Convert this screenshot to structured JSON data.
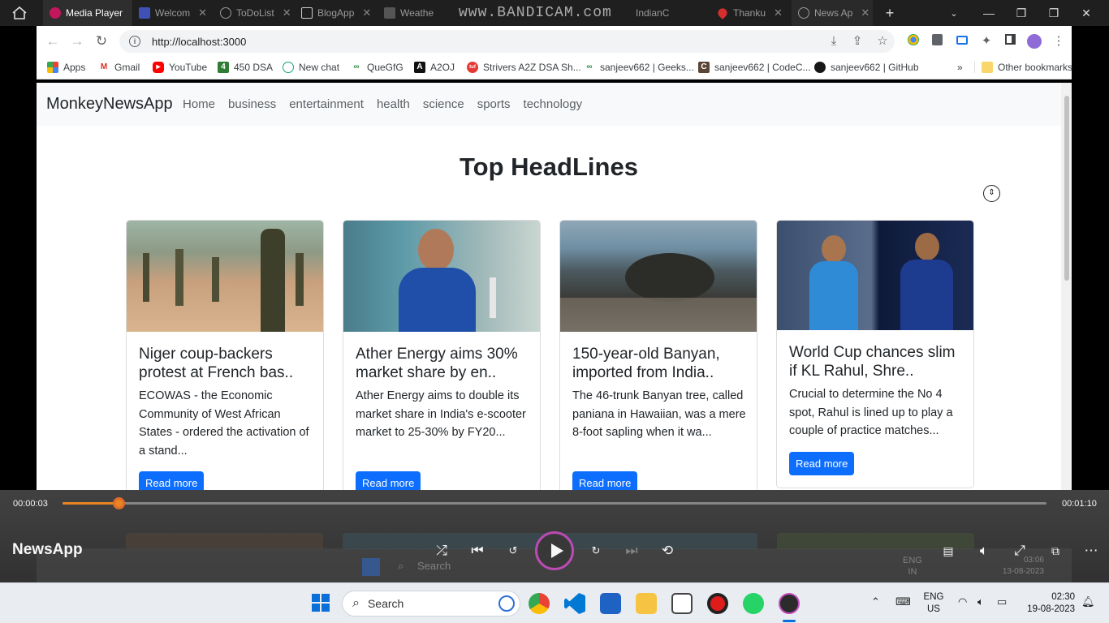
{
  "tabs": [
    {
      "label": "Media Player",
      "active": true
    },
    {
      "label": "Welcom",
      "active": false
    },
    {
      "label": "ToDoList",
      "active": false
    },
    {
      "label": "BlogApp",
      "active": false
    },
    {
      "label": "Weathe",
      "active": false
    },
    {
      "label": "IndianC",
      "active": false
    },
    {
      "label": "Thanku",
      "active": false
    },
    {
      "label": "News Ap",
      "active": false
    }
  ],
  "watermark": "www.BANDICAM.com",
  "address": {
    "url": "http://localhost:3000"
  },
  "bookmarks": [
    {
      "label": "Apps",
      "color": "#ea4335"
    },
    {
      "label": "Gmail",
      "color": "#d93025"
    },
    {
      "label": "YouTube",
      "color": "#ff0000"
    },
    {
      "label": "450 DSA",
      "color": "#2e7d32"
    },
    {
      "label": "New chat",
      "color": "#10a37f"
    },
    {
      "label": "QueGfG",
      "color": "#2f8d46"
    },
    {
      "label": "A2OJ",
      "color": "#111111"
    },
    {
      "label": "Strivers A2Z DSA Sh...",
      "color": "#e53935"
    },
    {
      "label": "sanjeev662 | Geeks...",
      "color": "#2f8d46"
    },
    {
      "label": "sanjeev662 | CodeC...",
      "color": "#5b4636"
    },
    {
      "label": "sanjeev662 | GitHub",
      "color": "#181717"
    }
  ],
  "bookmarks_more": "»",
  "other_bookmarks": "Other bookmarks",
  "navbar": {
    "brand": "MonkeyNewsApp",
    "links": [
      "Home",
      "business",
      "entertainment",
      "health",
      "science",
      "sports",
      "technology"
    ]
  },
  "page_title": "Top HeadLines",
  "cards": [
    {
      "title": "Niger coup-backers protest at French bas..",
      "desc": "ECOWAS - the Economic Community of West African States - ordered the activation of a stand...",
      "button": "Read more"
    },
    {
      "title": "Ather Energy aims 30% market share by en..",
      "desc": "Ather Energy aims to double its market share in India's e-scooter market to 25-30% by FY20...",
      "button": "Read more"
    },
    {
      "title": "150-year-old Banyan, imported from India..",
      "desc": "The 46-trunk Banyan tree, called paniana in Hawaiian, was a mere 8-foot sapling when it wa...",
      "button": "Read more"
    },
    {
      "title": "World Cup chances slim if KL Rahul, Shre..",
      "desc": "Crucial to determine the No 4 spot, Rahul is lined up to play a couple of practice matches...",
      "button": "Read more"
    }
  ],
  "player": {
    "title": "NewsApp",
    "elapsed": "00:00:03",
    "duration": "00:01:10",
    "progress": 0.057,
    "accent": "#f08a24"
  },
  "video_taskbar": {
    "search": "Search",
    "lang_top": "ENG",
    "lang_bottom": "IN",
    "time": "03:06",
    "date": "13-08-2023"
  },
  "taskbar": {
    "search": "Search",
    "lang_top": "ENG",
    "lang_bottom": "US",
    "time": "02:30",
    "date": "19-08-2023"
  }
}
